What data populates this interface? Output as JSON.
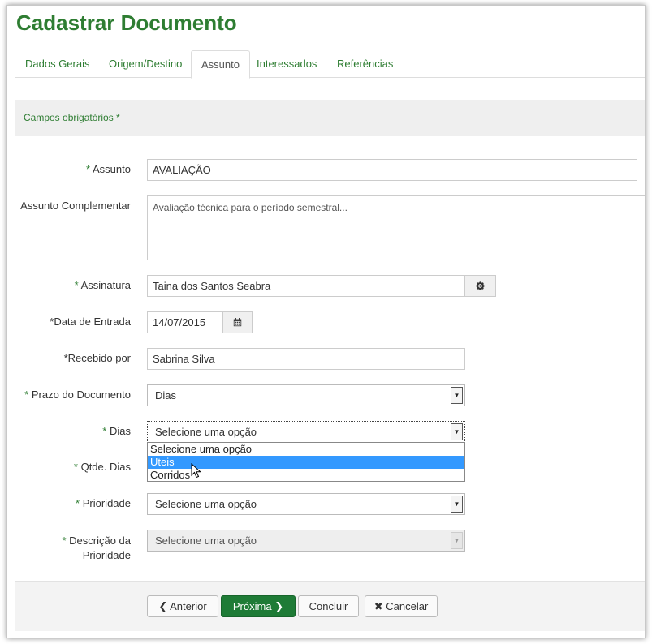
{
  "page": {
    "title": "Cadastrar Documento"
  },
  "tabs": [
    {
      "label": "Dados Gerais"
    },
    {
      "label": "Origem/Destino"
    },
    {
      "label": "Assunto"
    },
    {
      "label": "Interessados"
    },
    {
      "label": "Referências"
    }
  ],
  "active_tab": "Assunto",
  "banner": {
    "text": "Campos obrigatórios *"
  },
  "form": {
    "assunto": {
      "label": "Assunto",
      "value": "AVALIAÇÃO"
    },
    "assunto_complementar": {
      "label": "Assunto Complementar",
      "value": "Avaliação técnica para o período semestral..."
    },
    "assinatura": {
      "label": "Assinatura",
      "value": "Taina dos Santos Seabra"
    },
    "data_entrada": {
      "label": "Data de Entrada",
      "value": "14/07/2015"
    },
    "recebido_por": {
      "label": "Recebido por",
      "value": "Sabrina Silva"
    },
    "prazo": {
      "label": "Prazo do Documento",
      "value": "Dias"
    },
    "dias": {
      "label": "Dias",
      "value": "Selecione uma opção",
      "options": [
        "Selecione uma opção",
        "Uteis",
        "Corridos"
      ],
      "highlighted": "Uteis"
    },
    "qtde_dias": {
      "label": "Qtde. Dias"
    },
    "prioridade": {
      "label": "Prioridade",
      "value": "Selecione uma opção"
    },
    "descricao_prioridade": {
      "label_line1": "Descrição da",
      "label_line2": "Prioridade",
      "value": "Selecione uma opção"
    }
  },
  "required_marker": "*",
  "footer": {
    "anterior": "Anterior",
    "proxima": "Próxima",
    "concluir": "Concluir",
    "cancelar": "Cancelar"
  },
  "colors": {
    "brand": "#2e7d32",
    "primary_button": "#1e7b36",
    "highlight": "#3399ff"
  },
  "icons": [
    "gear-icon",
    "calendar-icon",
    "chevron-left-icon",
    "chevron-right-icon",
    "close-icon",
    "mouse-cursor-icon"
  ]
}
